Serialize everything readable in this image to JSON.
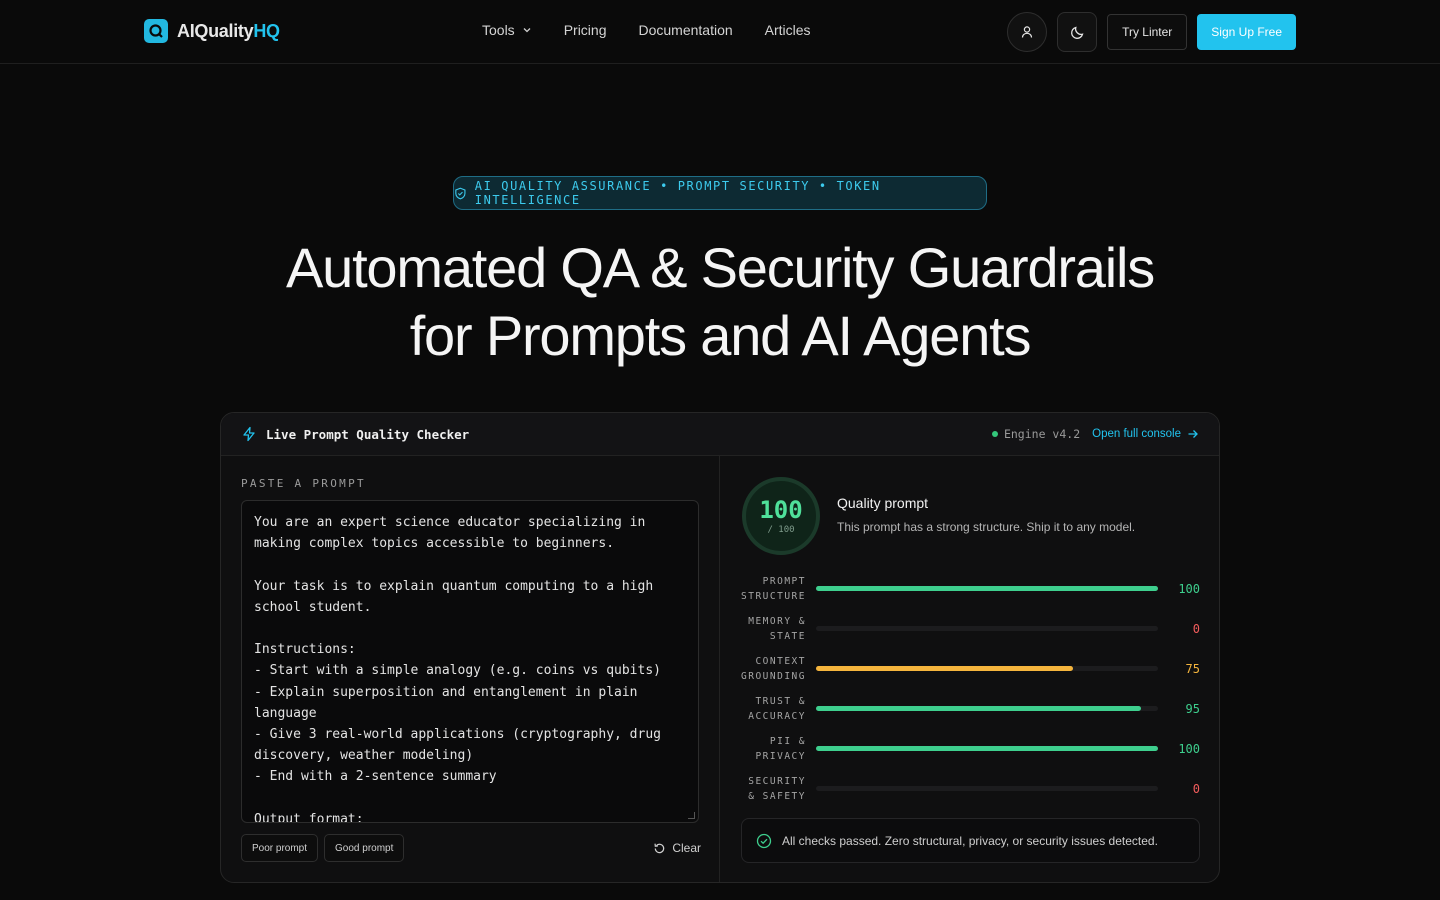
{
  "nav": {
    "logo_main": "AIQuality",
    "logo_accent": "HQ",
    "links": [
      "Tools",
      "Pricing",
      "Documentation",
      "Articles"
    ],
    "try_label": "Try Linter",
    "signup_label": "Sign Up Free"
  },
  "hero": {
    "badge": "AI QUALITY ASSURANCE • PROMPT SECURITY • TOKEN INTELLIGENCE",
    "title_line1": "Automated QA & Security Guardrails",
    "title_line2": "for Prompts and AI Agents"
  },
  "checker": {
    "title": "Live Prompt Quality Checker",
    "engine": "Engine v4.2",
    "console_link": "Open full console",
    "paste_label": "PASTE A PROMPT",
    "prompt_text": "You are an expert science educator specializing in\nmaking complex topics accessible to beginners.\n\nYour task is to explain quantum computing to a high\nschool student.\n\nInstructions:\n- Start with a simple analogy (e.g. coins vs qubits)\n- Explain superposition and entanglement in plain\nlanguage\n- Give 3 real-world applications (cryptography, drug\ndiscovery, weather modeling)\n- End with a 2-sentence summary\n\nOutput format:",
    "poor_label": "Poor prompt",
    "good_label": "Good prompt",
    "clear_label": "Clear",
    "score": "100",
    "score_den": "/ 100",
    "verdict": "Quality prompt",
    "verdict_sub": "This prompt has a strong structure. Ship it to any model.",
    "metrics": [
      {
        "line1": "PROMPT",
        "line2": "STRUCTURE",
        "value": 100,
        "display": "100",
        "color": "#3ecf8e"
      },
      {
        "line1": "MEMORY &",
        "line2": "STATE",
        "value": 0,
        "display": "0",
        "color": "#f25c5c"
      },
      {
        "line1": "CONTEXT",
        "line2": "GROUNDING",
        "value": 75,
        "display": "75",
        "color": "#f5b53d"
      },
      {
        "line1": "TRUST &",
        "line2": "ACCURACY",
        "value": 95,
        "display": "95",
        "color": "#3ecf8e"
      },
      {
        "line1": "PII &",
        "line2": "PRIVACY",
        "value": 100,
        "display": "100",
        "color": "#3ecf8e"
      },
      {
        "line1": "SECURITY",
        "line2": "& SAFETY",
        "value": 0,
        "display": "0",
        "color": "#f25c5c"
      }
    ],
    "pass_message": "All checks passed. Zero structural, privacy, or security issues detected."
  },
  "colors": {
    "accent": "#22c3ee",
    "good": "#3ecf8e",
    "warn": "#f5b53d",
    "bad": "#f25c5c"
  },
  "icons": [
    "logo-q-icon",
    "chevron-down-icon",
    "user-icon",
    "moon-icon",
    "shield-icon",
    "bolt-icon",
    "arrow-right-icon",
    "refresh-icon",
    "check-circle-icon"
  ]
}
